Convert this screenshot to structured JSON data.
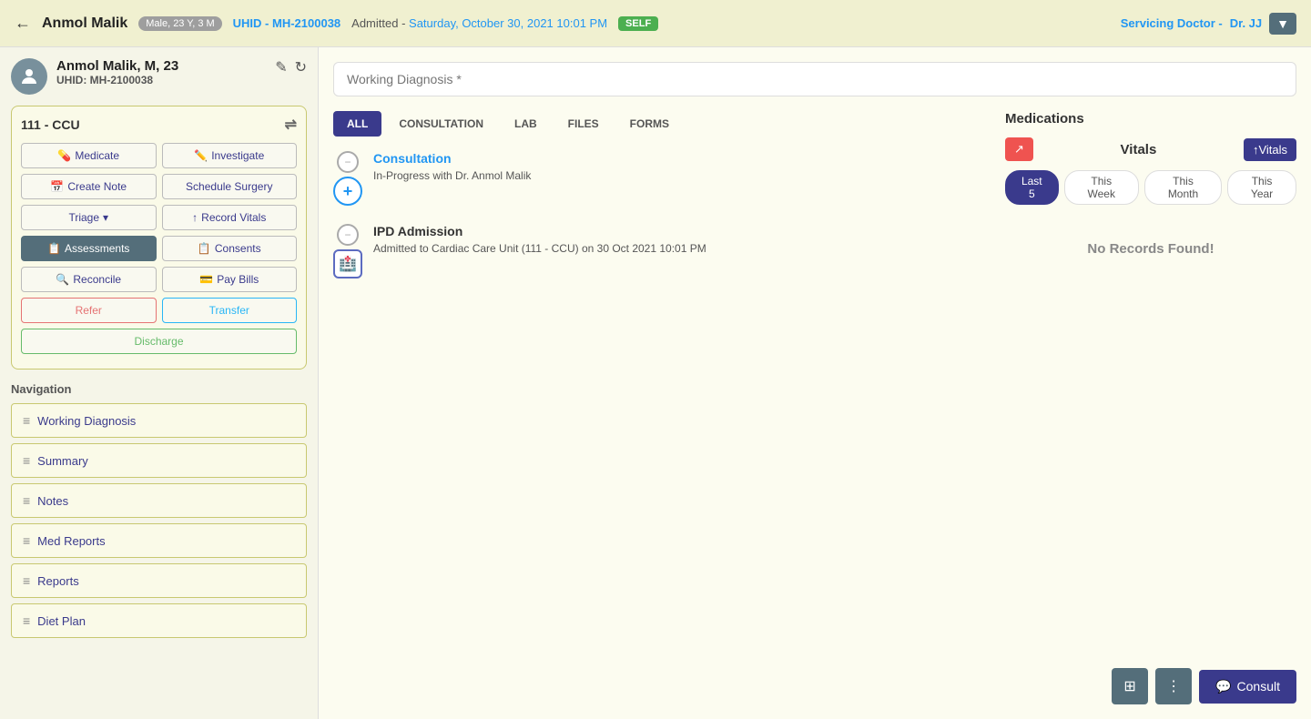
{
  "header": {
    "back_icon": "←",
    "patient_name": "Anmol Malik",
    "gender_age_badge": "Male, 23 Y, 3 M",
    "uhid_label": "UHID -",
    "uhid_value": "MH-2100038",
    "admitted_label": "Admitted -",
    "admitted_date": "Saturday, October 30, 2021 10:01 PM",
    "self_badge": "SELF",
    "servicing_doctor_label": "Servicing Doctor -",
    "servicing_doctor": "Dr. JJ",
    "dropdown_icon": "▼"
  },
  "sidebar": {
    "patient_name": "Anmol Malik, M, 23",
    "patient_uhid_label": "UHID:",
    "patient_uhid_value": "MH-2100038",
    "edit_icon": "✎",
    "refresh_icon": "↻",
    "ward": {
      "title": "111 - CCU",
      "transfer_icon": "⇌",
      "buttons": [
        {
          "id": "medicate",
          "label": "Medicate",
          "icon": "💊"
        },
        {
          "id": "investigate",
          "label": "Investigate",
          "icon": "🔬"
        },
        {
          "id": "create-note",
          "label": "Create Note",
          "icon": "📅"
        },
        {
          "id": "schedule-surgery",
          "label": "Schedule Surgery",
          "icon": ""
        },
        {
          "id": "triage",
          "label": "Triage",
          "icon": "",
          "has_dropdown": true
        },
        {
          "id": "record-vitals",
          "label": "Record Vitals",
          "icon": "↑"
        },
        {
          "id": "assessments",
          "label": "Assessments",
          "icon": "📋",
          "active": true
        },
        {
          "id": "consents",
          "label": "Consents",
          "icon": "📋"
        },
        {
          "id": "reconcile",
          "label": "Reconcile",
          "icon": "🔍"
        },
        {
          "id": "pay-bills",
          "label": "Pay Bills",
          "icon": "💳"
        },
        {
          "id": "refer",
          "label": "Refer",
          "type": "refer"
        },
        {
          "id": "transfer",
          "label": "Transfer",
          "type": "transfer"
        },
        {
          "id": "discharge",
          "label": "Discharge",
          "type": "discharge"
        }
      ]
    },
    "navigation": {
      "title": "Navigation",
      "items": [
        {
          "id": "working-diagnosis",
          "label": "Working Diagnosis"
        },
        {
          "id": "summary",
          "label": "Summary"
        },
        {
          "id": "notes",
          "label": "Notes"
        },
        {
          "id": "med-reports",
          "label": "Med Reports"
        },
        {
          "id": "reports",
          "label": "Reports"
        },
        {
          "id": "diet-plan",
          "label": "Diet Plan"
        }
      ]
    }
  },
  "content": {
    "diagnosis_placeholder": "Working Diagnosis *",
    "tabs": [
      {
        "id": "all",
        "label": "ALL",
        "active": true
      },
      {
        "id": "consultation",
        "label": "CONSULTATION"
      },
      {
        "id": "lab",
        "label": "LAB"
      },
      {
        "id": "files",
        "label": "FILES"
      },
      {
        "id": "forms",
        "label": "FORMS"
      }
    ],
    "timeline_items": [
      {
        "id": "consultation",
        "type": "consultation",
        "title": "Consultation",
        "subtitle": "In-Progress with Dr. Anmol Malik"
      },
      {
        "id": "ipd-admission",
        "type": "admission",
        "title": "IPD Admission",
        "subtitle": "Admitted to Cardiac Care Unit (111 - CCU) on 30 Oct 2021 10:01 PM"
      }
    ]
  },
  "vitals": {
    "title": "Vitals",
    "red_btn_icon": "↗",
    "vitals_btn_label": "↑Vitals",
    "time_filters": [
      {
        "id": "last5",
        "label": "Last 5",
        "active": true
      },
      {
        "id": "this-week",
        "label": "This Week"
      },
      {
        "id": "this-month",
        "label": "This Month"
      },
      {
        "id": "this-year",
        "label": "This Year"
      }
    ],
    "no_records": "No Records Found!"
  },
  "medications": {
    "title": "Medications"
  },
  "bottom_actions": {
    "grid_icon": "⊞",
    "more_icon": "⋮",
    "consult_icon": "💬",
    "consult_label": "Consult"
  }
}
